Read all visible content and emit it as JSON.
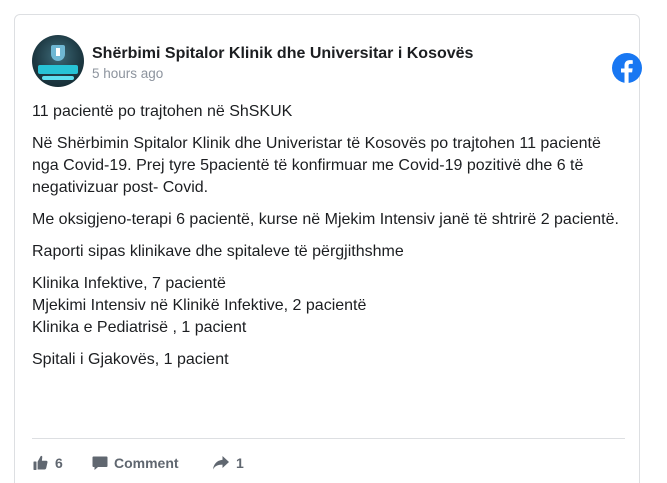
{
  "post": {
    "page_name": "Shërbimi Spitalor Klinik dhe Universitar i Kosovës",
    "timestamp": "5 hours ago",
    "paragraphs": [
      "11 pacientë po trajtohen në ShSKUK",
      "Në Shërbimin Spitalor Klinik dhe Univeristar të Kosovës po trajtohen 11 pacientë nga Covid-19. Prej tyre 5pacientë të konfirmuar me Covid-19 pozitivë dhe 6 të negativizuar post- Covid.",
      "Me oksigjeno-terapi 6 pacientë, kurse në Mjekim Intensiv janë të shtrirë 2 pacientë.",
      "Raporti sipas klinikave dhe spitaleve të përgjithshme",
      "Klinika Infektive, 7 pacientë",
      "Mjekimi Intensiv në Klinikë Infektive, 2 pacientë",
      "Klinika e Pediatrisë , 1 pacient",
      "Spitali i Gjakovës, 1 pacient"
    ]
  },
  "actions": {
    "like_count": "6",
    "comment_label": "Comment",
    "share_count": "1"
  },
  "icons": {
    "facebook": "facebook-logo-icon",
    "like": "thumbs-up-icon",
    "comment": "speech-bubble-icon",
    "share": "share-arrow-icon"
  },
  "colors": {
    "facebook_blue": "#1877f2",
    "action_gray": "#606770",
    "timestamp_gray": "#8d949e"
  }
}
